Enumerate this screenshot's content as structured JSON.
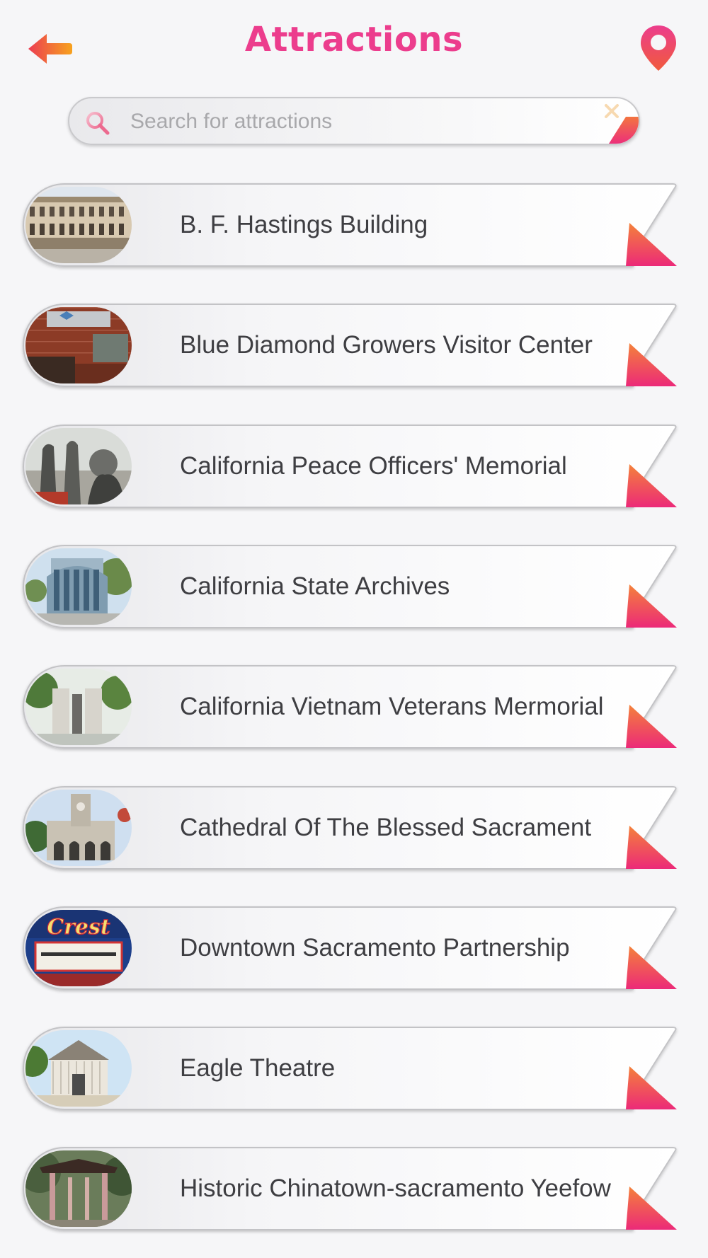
{
  "header": {
    "title": "Attractions",
    "back_icon": "back-arrow-icon",
    "map_icon": "map-pin-icon"
  },
  "search": {
    "placeholder": "Search for attractions",
    "value": "",
    "search_icon": "magnifier-icon",
    "clear_icon": "close-icon"
  },
  "colors": {
    "accent": "#ec3d8d",
    "accent_orange": "#f58a1f",
    "background": "#f6f6f8",
    "text": "#3e3e42"
  },
  "attractions": [
    {
      "label": "B. F. Hastings Building",
      "thumb": "building-photo"
    },
    {
      "label": "Blue Diamond Growers Visitor Center",
      "thumb": "visitor-center-photo"
    },
    {
      "label": "California Peace Officers' Memorial",
      "thumb": "statue-photo"
    },
    {
      "label": "California State Archives",
      "thumb": "archives-building-photo"
    },
    {
      "label": "California Vietnam Veterans Mermorial",
      "thumb": "memorial-photo"
    },
    {
      "label": "Cathedral Of The Blessed Sacrament",
      "thumb": "cathedral-photo"
    },
    {
      "label": "Downtown Sacramento Partnership",
      "thumb": "theatre-sign-photo"
    },
    {
      "label": "Eagle Theatre",
      "thumb": "eagle-theatre-photo"
    },
    {
      "label": "Historic Chinatown-sacramento Yeefow",
      "thumb": "chinatown-gate-photo"
    }
  ]
}
